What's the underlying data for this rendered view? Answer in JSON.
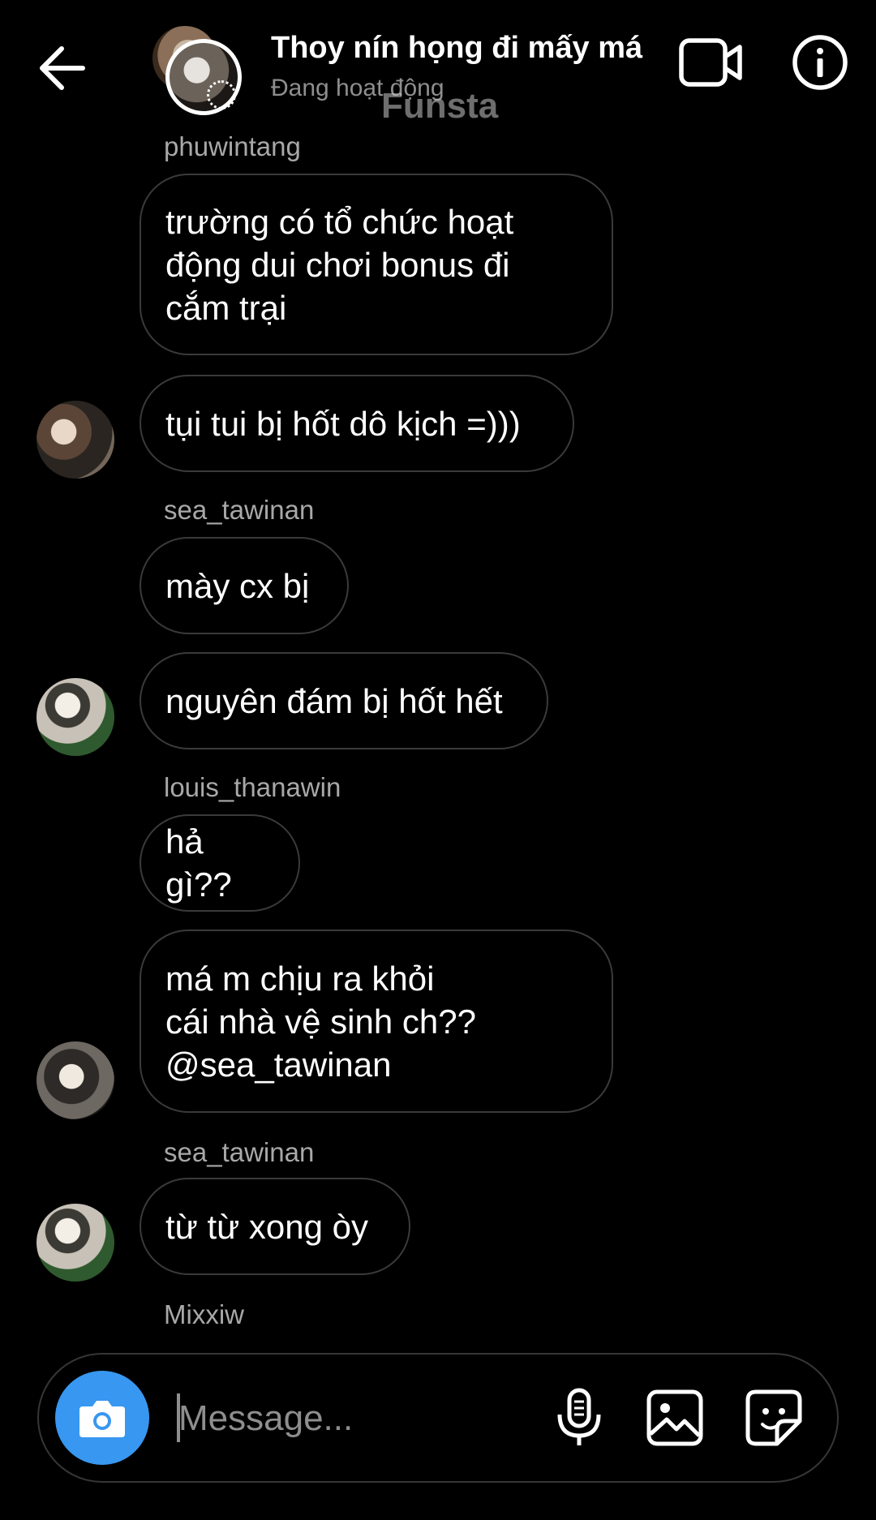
{
  "header": {
    "title": "Thoy nín họng đi mấy má",
    "subtitle": "Đang hoạt động",
    "watermark": "Funsta"
  },
  "messages": [
    {
      "username": "phuwintang",
      "text": "trường có tổ chức hoạt\nđộng dui chơi bonus đi\ncắm trại"
    },
    {
      "text": "tụi tui bị hốt dô kịch =)))"
    },
    {
      "username": "sea_tawinan",
      "text": "mày cx bị"
    },
    {
      "text": "nguyên đám bị hốt hết"
    },
    {
      "username": "louis_thanawin",
      "text": "hả gì??"
    },
    {
      "text": "má m chịu ra khỏi\ncái nhà vệ sinh ch??\n@sea_tawinan"
    },
    {
      "username": "sea_tawinan",
      "text": "từ từ xong òy"
    },
    {
      "username": "Mixxiw"
    }
  ],
  "composer": {
    "placeholder": "Message..."
  },
  "icons": {
    "back": "arrow-left-icon",
    "video": "video-camera-icon",
    "info": "info-icon",
    "camera": "camera-icon",
    "mic": "microphone-icon",
    "gallery": "image-icon",
    "sticker": "sticker-icon"
  },
  "colors": {
    "background": "#000000",
    "accent": "#3897f0",
    "bubble_border": "#3a3a3a",
    "secondary_text": "#a8a8a8"
  }
}
